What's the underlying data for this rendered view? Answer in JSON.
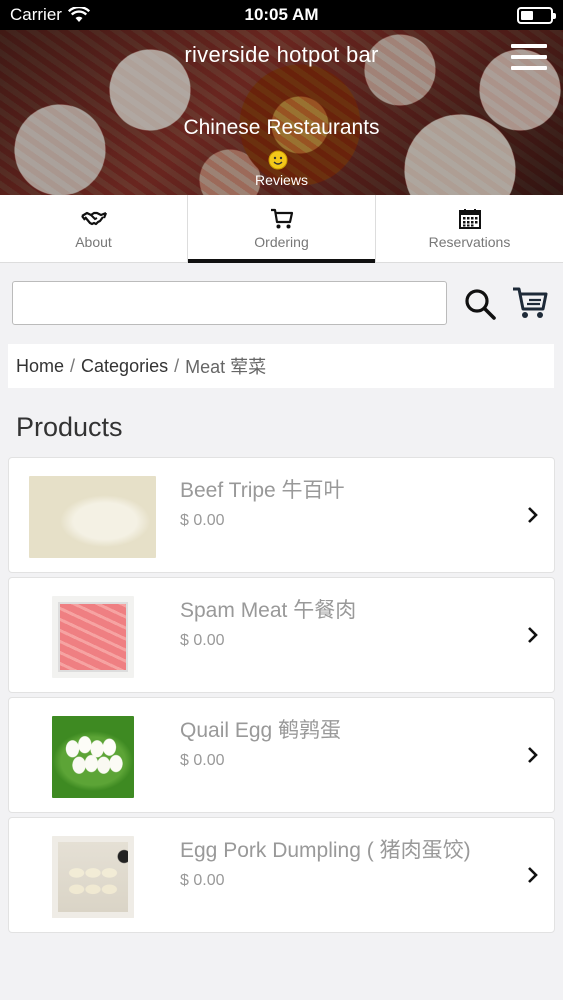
{
  "status_bar": {
    "carrier": "Carrier",
    "time": "10:05 AM"
  },
  "hero": {
    "title": "riverside hotpot bar",
    "category": "Chinese Restaurants",
    "reviews_label": "Reviews"
  },
  "tabs": [
    {
      "label": "About",
      "icon": "handshake-icon",
      "active": false
    },
    {
      "label": "Ordering",
      "icon": "cart-icon",
      "active": true
    },
    {
      "label": "Reservations",
      "icon": "calendar-icon",
      "active": false
    }
  ],
  "search": {
    "value": "",
    "placeholder": ""
  },
  "breadcrumb": {
    "home": "Home",
    "sep1": "/",
    "categories": "Categories",
    "sep2": "/",
    "current": "Meat 荤菜"
  },
  "section_title": "Products",
  "products": [
    {
      "name": "Beef Tripe 牛百叶",
      "price": "$ 0.00"
    },
    {
      "name": "Spam Meat 午餐肉",
      "price": "$ 0.00"
    },
    {
      "name": "Quail Egg 鹌鹑蛋",
      "price": "$ 0.00"
    },
    {
      "name": "Egg Pork Dumpling ( 猪肉蛋饺)",
      "price": "$ 0.00"
    }
  ],
  "colors": {
    "active_tab_indicator": "#111111",
    "page_background": "#f2f2f4",
    "muted_text": "#999999"
  }
}
